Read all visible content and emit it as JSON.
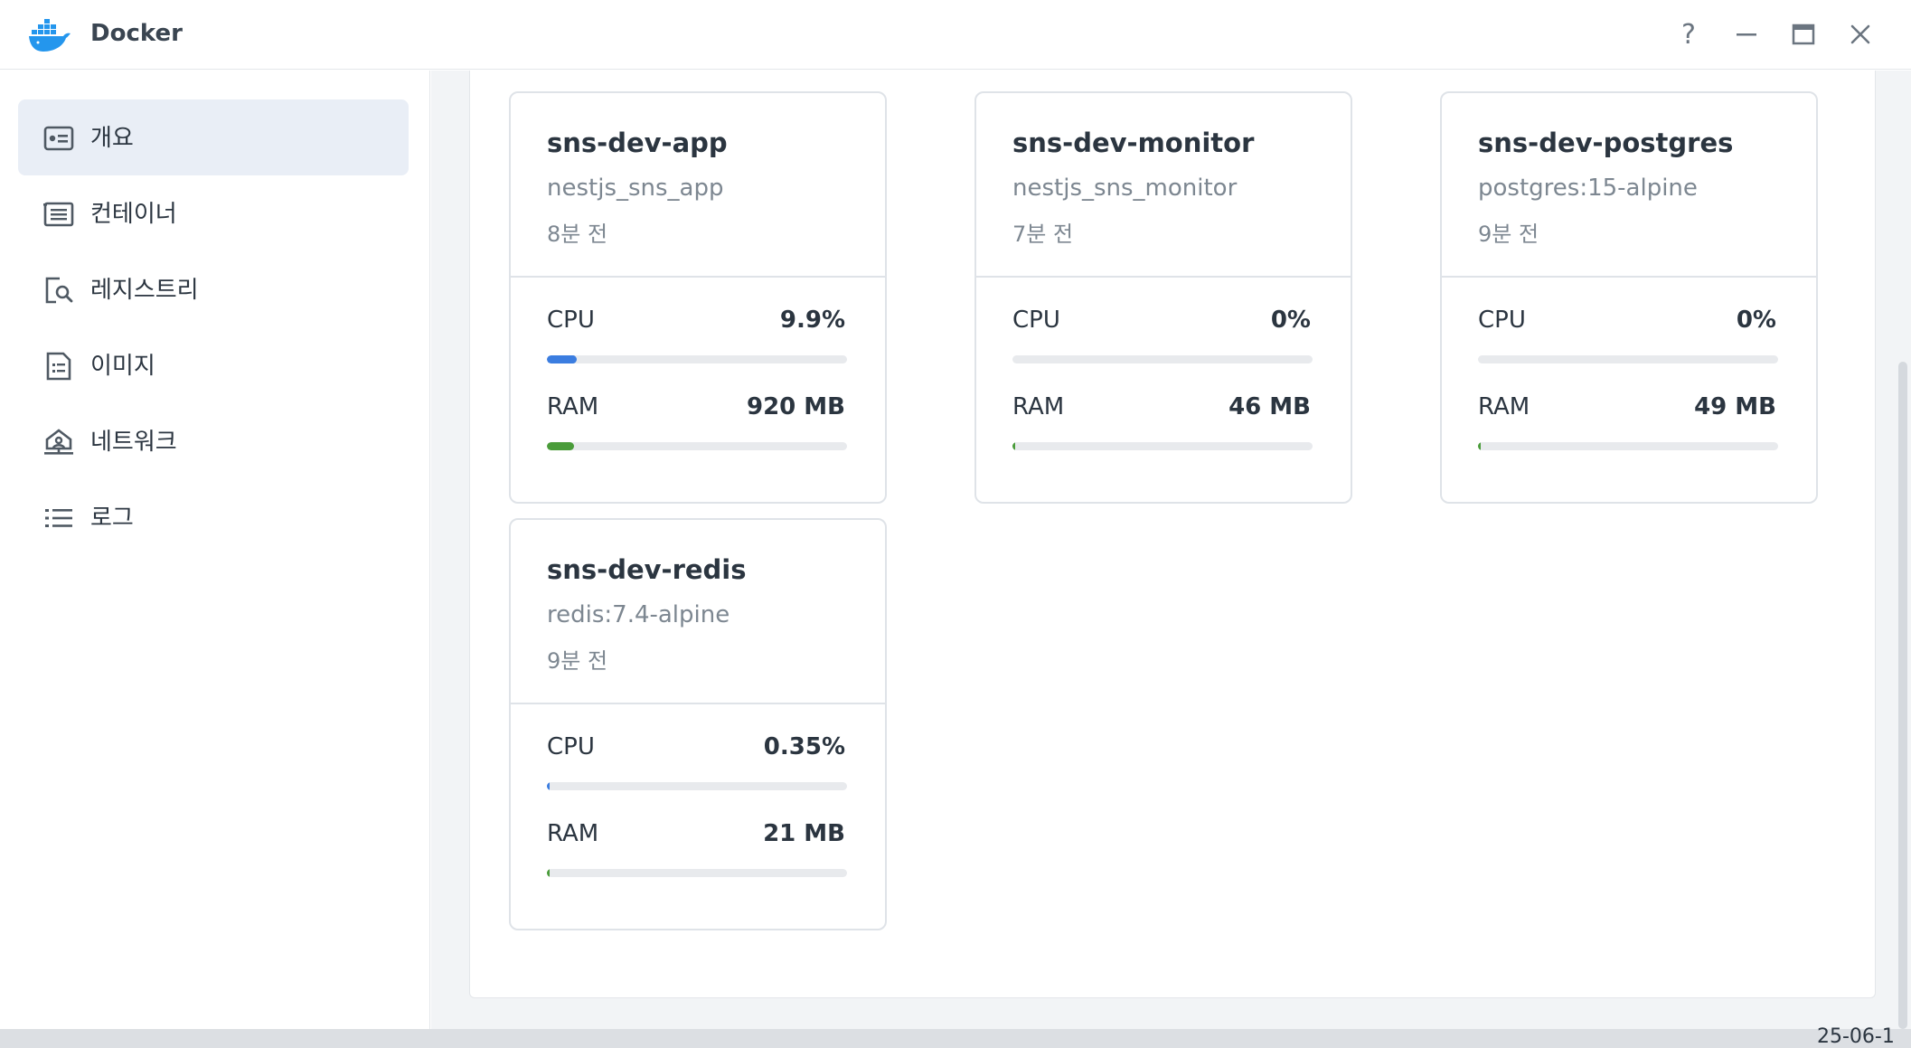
{
  "window": {
    "title": "Docker"
  },
  "sidebar": {
    "items": [
      {
        "label": "개요",
        "icon": "overview-icon",
        "active": true
      },
      {
        "label": "컨테이너",
        "icon": "container-icon",
        "active": false
      },
      {
        "label": "레지스트리",
        "icon": "registry-icon",
        "active": false
      },
      {
        "label": "이미지",
        "icon": "image-icon",
        "active": false
      },
      {
        "label": "네트워크",
        "icon": "network-icon",
        "active": false
      },
      {
        "label": "로그",
        "icon": "log-icon",
        "active": false
      }
    ]
  },
  "containers": [
    {
      "name": "sns-dev-app",
      "image": "nestjs_sns_app",
      "time": "8분 전",
      "cpu_label": "CPU",
      "cpu_value": "9.9%",
      "cpu_fraction": 0.099,
      "ram_label": "RAM",
      "ram_value": "920 MB",
      "ram_fraction": 0.09
    },
    {
      "name": "sns-dev-monitor",
      "image": "nestjs_sns_monitor",
      "time": "7분 전",
      "cpu_label": "CPU",
      "cpu_value": "0%",
      "cpu_fraction": 0,
      "ram_label": "RAM",
      "ram_value": "46 MB",
      "ram_fraction": 0.005
    },
    {
      "name": "sns-dev-postgres",
      "image": "postgres:15-alpine",
      "time": "9분 전",
      "cpu_label": "CPU",
      "cpu_value": "0%",
      "cpu_fraction": 0,
      "ram_label": "RAM",
      "ram_value": "49 MB",
      "ram_fraction": 0.005
    },
    {
      "name": "sns-dev-redis",
      "image": "redis:7.4-alpine",
      "time": "9분 전",
      "cpu_label": "CPU",
      "cpu_value": "0.35%",
      "cpu_fraction": 0.0035,
      "ram_label": "RAM",
      "ram_value": "21 MB",
      "ram_fraction": 0.003
    }
  ],
  "background": {
    "partial_text": "25-06-1"
  },
  "colors": {
    "cpu_bar": "#3b7de0",
    "ram_bar": "#4a9c3a",
    "active_nav": "#e9eef6",
    "docker_blue": "#2496ed"
  }
}
